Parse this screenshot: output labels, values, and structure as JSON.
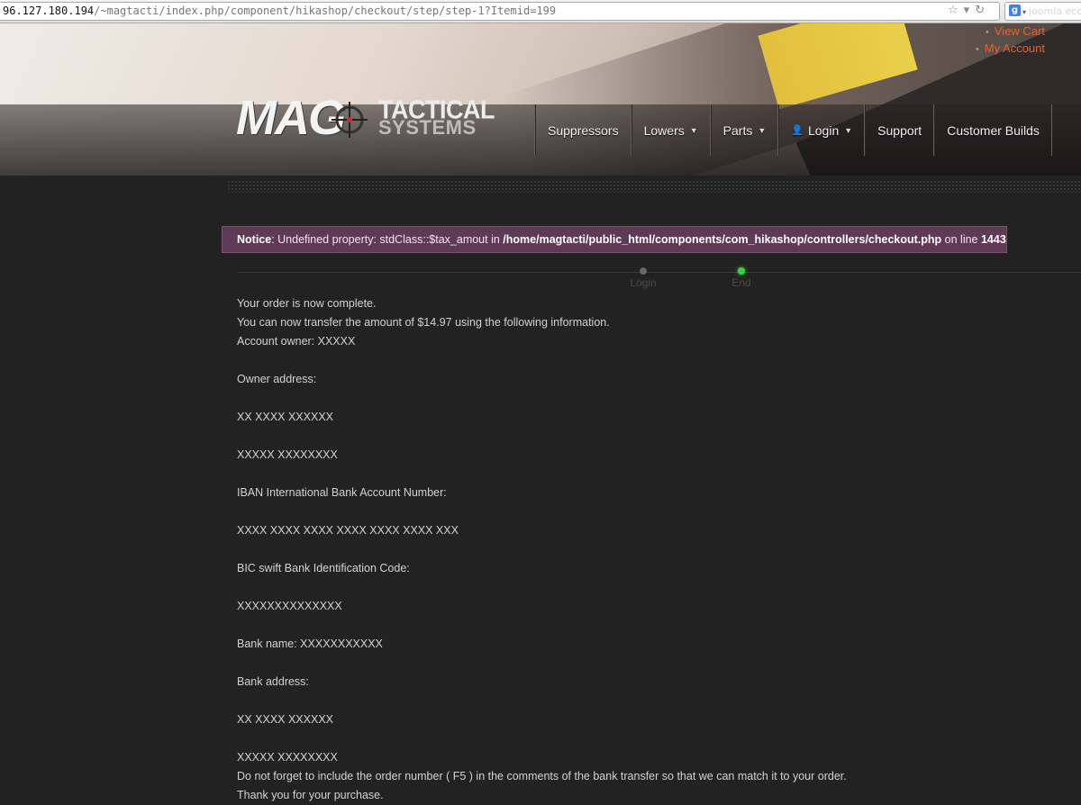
{
  "browser": {
    "url_host": "96.127.180.194",
    "url_path": "/~magtacti/index.php/component/hikashop/checkout/step/step-1?Itemid=199",
    "search_text": "joomla eco"
  },
  "header": {
    "top_links": [
      "View Cart",
      "My Account"
    ],
    "logo": {
      "word1": "MAG",
      "word2": "TACTICAL",
      "word3": "SYSTEMS"
    },
    "nav": [
      {
        "label": "Suppressors",
        "dropdown": false
      },
      {
        "label": "Lowers",
        "dropdown": true
      },
      {
        "label": "Parts",
        "dropdown": true
      },
      {
        "label": "Login",
        "dropdown": true,
        "icon": "user-icon"
      },
      {
        "label": "Support",
        "dropdown": false
      },
      {
        "label": "Customer Builds",
        "dropdown": false
      }
    ]
  },
  "notice": {
    "prefix": "Notice",
    "message": ": Undefined property: stdClass::$tax_amout in ",
    "path": "/home/magtacti/public_html/components/com_hikashop/controllers/checkout.php",
    "middle": " on line ",
    "line": "1443"
  },
  "steps": [
    {
      "label": "Login",
      "state": "done"
    },
    {
      "label": "End",
      "state": "current"
    }
  ],
  "content_lines": [
    "Your order is now complete.",
    "You can now transfer the amount of $14.97 using the following information.",
    "Account owner: XXXXX",
    "",
    "Owner address:",
    "",
    "XX XXXX XXXXXX",
    "",
    "XXXXX XXXXXXXX",
    "",
    "IBAN International Bank Account Number:",
    "",
    "XXXX XXXX XXXX XXXX XXXX XXXX XXX",
    "",
    "BIC swift Bank Identification Code:",
    "",
    "XXXXXXXXXXXXXX",
    "",
    "Bank name: XXXXXXXXXXX",
    "",
    "Bank address:",
    "",
    "XX XXXX XXXXXX",
    "",
    "XXXXX XXXXXXXX",
    "Do not forget to include the order number ( F5 ) in the comments of the bank transfer so that we can match it to your order.",
    "Thank you for your purchase."
  ]
}
